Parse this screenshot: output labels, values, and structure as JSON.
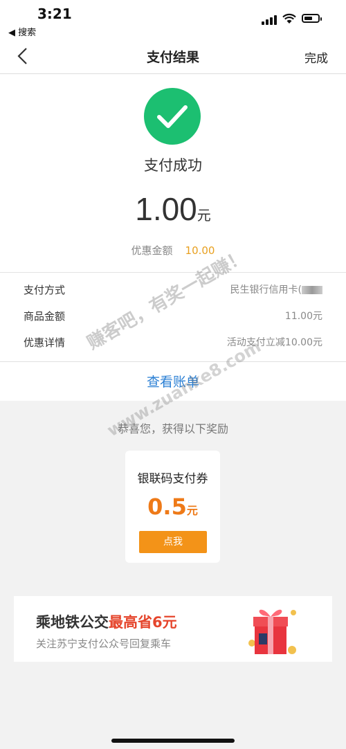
{
  "status": {
    "time": "3:21",
    "back_app": "◀ 搜索"
  },
  "nav": {
    "title": "支付结果",
    "done_label": "完成"
  },
  "result": {
    "status_text": "支付成功",
    "amount": "1.00",
    "currency_unit": "元",
    "discount_label": "优惠金额",
    "discount_value": "10.00"
  },
  "details": [
    {
      "label": "支付方式",
      "value": "民生银行信用卡("
    },
    {
      "label": "商品金额",
      "value": "11.00元"
    },
    {
      "label": "优惠详情",
      "value": "活动支付立减10.00元"
    }
  ],
  "bill_link": "查看账单",
  "reward": {
    "congrats": "恭喜您，获得以下奖励",
    "coupon_title": "银联码支付券",
    "coupon_amount": "0.5",
    "coupon_unit": "元",
    "coupon_button": "点我"
  },
  "banner": {
    "title_main": "乘地铁公交",
    "title_highlight": "最高省6元",
    "subtitle": "关注苏宁支付公众号回复乘车"
  },
  "watermark": {
    "line1": "赚客吧，有奖一起赚！",
    "line2": "www.zuanke8.com"
  },
  "colors": {
    "success_green": "#1cbf71",
    "link_blue": "#2a7fd4",
    "accent_orange": "#f39318",
    "discount_gold": "#e8a020",
    "banner_red": "#e5452c"
  }
}
